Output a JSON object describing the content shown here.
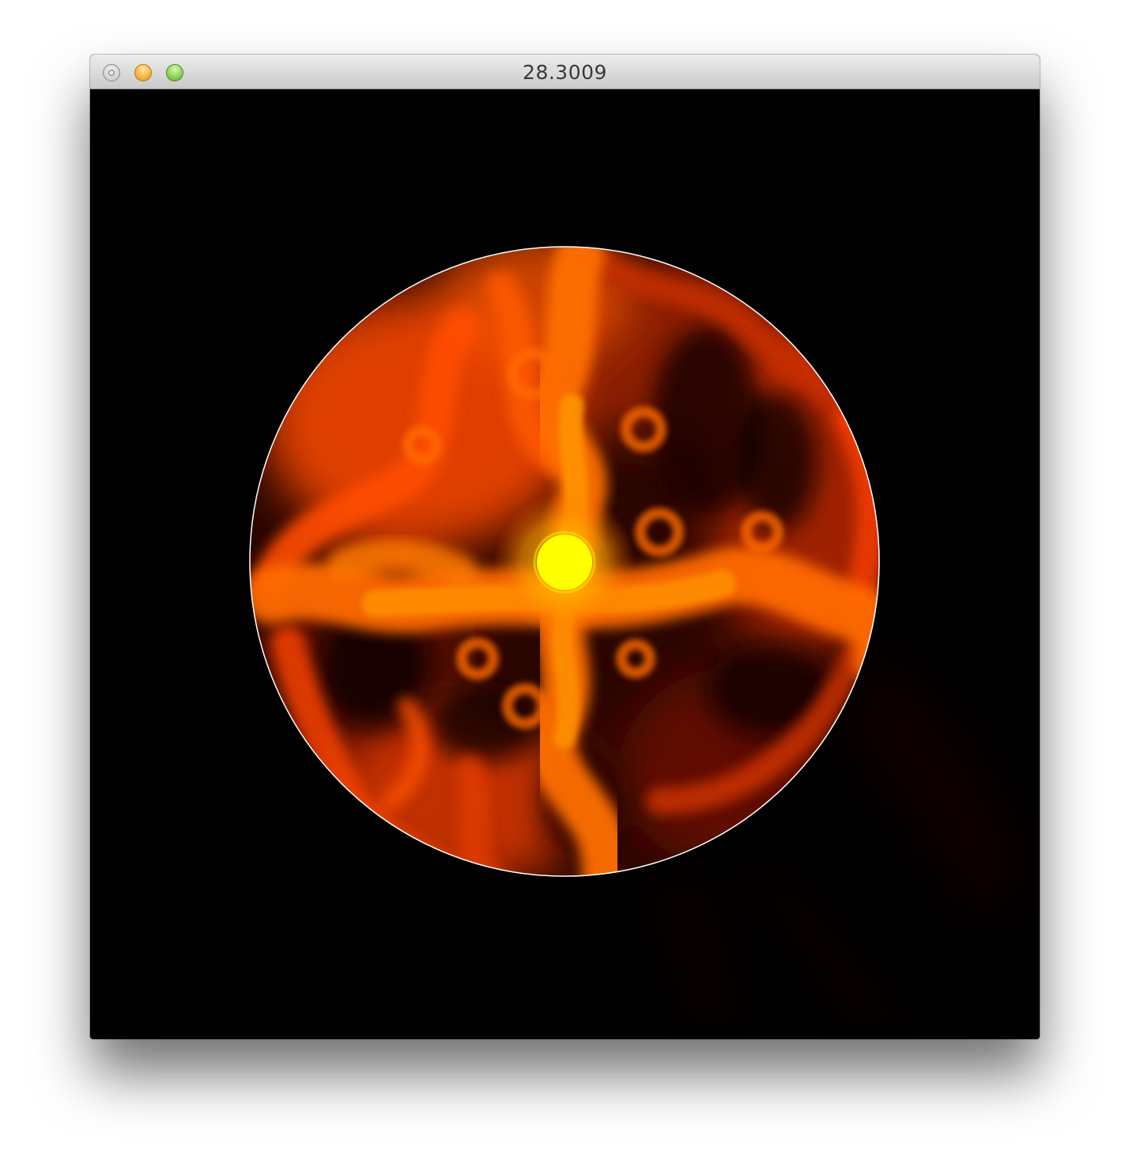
{
  "window": {
    "title": "28.3009",
    "buttons": {
      "close": "close-button",
      "minimize": "minimize-button",
      "zoom": "zoom-button"
    }
  },
  "canvas": {
    "background": "#000000",
    "boundary_circle_color": "#ffffff",
    "core_color": "#ffff00",
    "flame_colors": [
      "#ff4500",
      "#ff6a00",
      "#ff8c00",
      "#cc2a00",
      "#5a0f00"
    ]
  }
}
